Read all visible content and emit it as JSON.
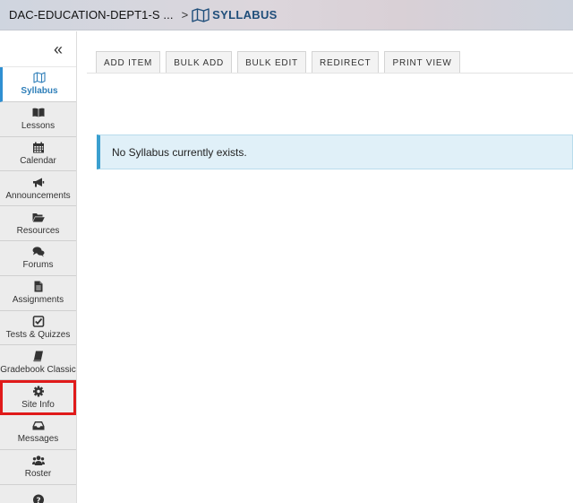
{
  "header": {
    "site_title": "DAC-EDUCATION-DEPT1-S ...",
    "separator": ">",
    "tool_name": "SYLLABUS"
  },
  "sidebar": {
    "collapse_glyph": "«",
    "items": [
      {
        "label": "Syllabus",
        "icon": "map-icon",
        "active": true
      },
      {
        "label": "Lessons",
        "icon": "book-open-icon"
      },
      {
        "label": "Calendar",
        "icon": "calendar-icon"
      },
      {
        "label": "Announcements",
        "icon": "bullhorn-icon"
      },
      {
        "label": "Resources",
        "icon": "folder-open-icon"
      },
      {
        "label": "Forums",
        "icon": "comments-icon"
      },
      {
        "label": "Assignments",
        "icon": "file-text-icon"
      },
      {
        "label": "Tests & Quizzes",
        "icon": "check-square-icon"
      },
      {
        "label": "Gradebook Classic",
        "icon": "book-icon"
      },
      {
        "label": "Site Info",
        "icon": "gear-icon",
        "highlighted": true
      },
      {
        "label": "Messages",
        "icon": "inbox-icon"
      },
      {
        "label": "Roster",
        "icon": "users-icon"
      },
      {
        "label": "",
        "icon": "question-circle-icon"
      }
    ]
  },
  "toolbar": {
    "add_item": "ADD ITEM",
    "bulk_add": "BULK ADD",
    "bulk_edit": "BULK EDIT",
    "redirect": "REDIRECT",
    "print_view": "PRINT VIEW"
  },
  "notice": {
    "message": "No Syllabus currently exists."
  },
  "colors": {
    "accent": "#2f8fd2",
    "highlight_box": "#e01a1a",
    "info_bg": "#e0f0f8"
  }
}
